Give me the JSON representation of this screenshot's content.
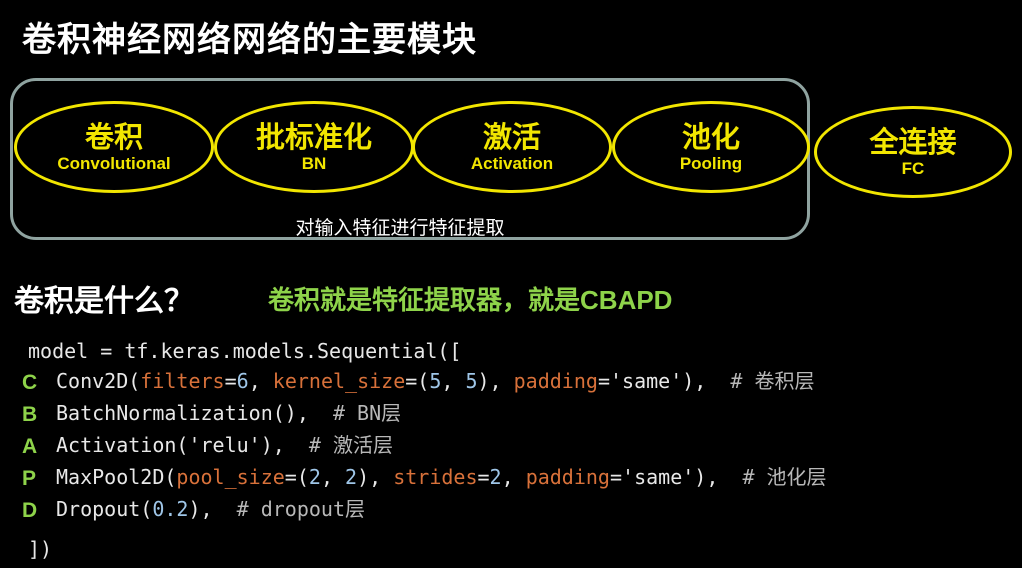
{
  "title": "卷积神经网络网络的主要模块",
  "modules": [
    {
      "zh": "卷积",
      "en": "Convolutional"
    },
    {
      "zh": "批标准化",
      "en": "BN"
    },
    {
      "zh": "激活",
      "en": "Activation"
    },
    {
      "zh": "池化",
      "en": "Pooling"
    },
    {
      "zh": "全连接",
      "en": "FC"
    }
  ],
  "group_caption": "对输入特征进行特征提取",
  "question": "卷积是什么？",
  "answer": {
    "prefix": "卷积就是特征提取器，就是",
    "acronym": "CBAPD"
  },
  "code": {
    "open_line": "model = tf.keras.models.Sequential([",
    "close_line": "])",
    "letters": [
      "C",
      "B",
      "A",
      "P",
      "D"
    ],
    "conv": {
      "fn": "Conv2D(",
      "k1": "filters",
      "v1": "6",
      "k2": "kernel_size",
      "v2a": "5",
      "v2b": "5",
      "k3": "padding",
      "v3": "'same'",
      "comment": "# 卷积层"
    },
    "bn": {
      "fn": "BatchNormalization(),",
      "comment": "# BN层"
    },
    "act": {
      "fn": "Activation(",
      "v": "'relu'",
      "comment": "# 激活层"
    },
    "pool": {
      "fn": "MaxPool2D(",
      "k1": "pool_size",
      "v1a": "2",
      "v1b": "2",
      "k2": "strides",
      "v2": "2",
      "k3": "padding",
      "v3": "'same'",
      "comment": "# 池化层"
    },
    "drop": {
      "fn": "Dropout(",
      "v": "0.2",
      "comment": "# dropout层"
    }
  },
  "colors": {
    "background": "#000000",
    "ellipse": "#f2e600",
    "group_border": "#8fa3a0",
    "answer": "#8ed34a",
    "keyword": "#d8713a",
    "number": "#9fc6e8"
  }
}
